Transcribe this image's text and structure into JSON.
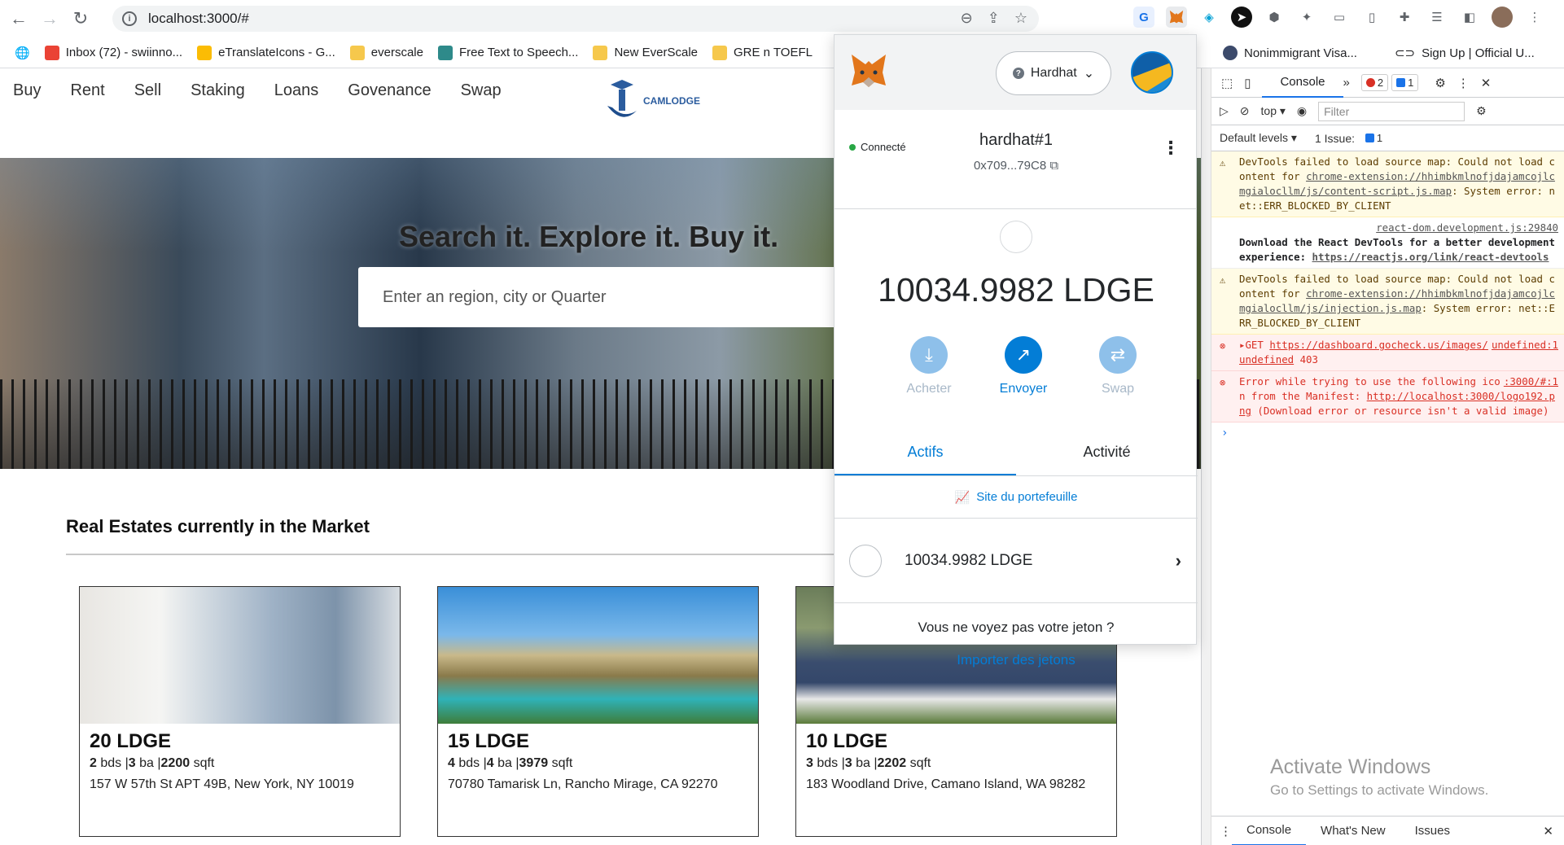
{
  "browser": {
    "url": "localhost:3000/#",
    "bookmarks": [
      {
        "label": "Inbox (72) - swiinno...",
        "color": "#ea4335"
      },
      {
        "label": "eTranslateIcons - G...",
        "color": "#fbbc04"
      },
      {
        "label": "everscale",
        "color": "#f6c84c"
      },
      {
        "label": "Free Text to Speech...",
        "color": "#2e8a8a"
      },
      {
        "label": "New EverScale",
        "color": "#f6c84c"
      },
      {
        "label": "GRE n TOEFL",
        "color": "#f6c84c"
      }
    ],
    "bookmarks_right": [
      "Nonimmigrant Visa...",
      "Sign Up | Official U..."
    ]
  },
  "site": {
    "nav": [
      "Buy",
      "Rent",
      "Sell",
      "Staking",
      "Loans",
      "Govenance",
      "Swap"
    ],
    "logo_text": "CAMLODGE",
    "hero_title": "Search it. Explore it. Buy it.",
    "search_placeholder": "Enter an region, city or Quarter",
    "section_title": "Real Estates currently in the Market",
    "listings": [
      {
        "price": "20 LDGE",
        "beds": "2",
        "baths": "3",
        "sqft": "2200",
        "address": "157 W 57th St APT 49B, New York, NY 10019",
        "image": "interior-living-room"
      },
      {
        "price": "15 LDGE",
        "beds": "4",
        "baths": "4",
        "sqft": "3979",
        "address": "70780 Tamarisk Ln, Rancho Mirage, CA 92270",
        "image": "pool-house"
      },
      {
        "price": "10 LDGE",
        "beds": "3",
        "baths": "3",
        "sqft": "2202",
        "address": "183 Woodland Drive, Camano Island, WA 98282",
        "image": "blue-house-forest"
      }
    ],
    "labels": {
      "beds": "bds",
      "baths": "ba",
      "sqft": "sqft",
      "sep": "|"
    }
  },
  "metamask": {
    "network": "Hardhat",
    "connected": "Connecté",
    "account_name": "hardhat#1",
    "address": "0x709...79C8",
    "balance": "10034.9982 LDGE",
    "actions": [
      "Acheter",
      "Envoyer",
      "Swap"
    ],
    "tabs": [
      "Actifs",
      "Activité"
    ],
    "portfolio_link": "Site du portefeuille",
    "asset_balance": "10034.9982 LDGE",
    "no_token_text": "Vous ne voyez pas votre jeton ?",
    "import_link": "Importer des jetons",
    "accent": "#037dd6"
  },
  "devtools": {
    "tabs": [
      "Console"
    ],
    "error_count": "2",
    "info_count": "1",
    "context": "top",
    "filter_placeholder": "Filter",
    "default_levels": "Default levels",
    "issues": "1 Issue:",
    "issue_count": "1",
    "messages": [
      {
        "level": "warn",
        "text": "DevTools failed to load source map: Could not load content for ",
        "link": "chrome-extension://hhimbkmlnofjdajamcojlcmgialocllm/js/content-script.js.map",
        "tail": ": System error: net::ERR_BLOCKED_BY_CLIENT"
      },
      {
        "level": "info",
        "source": "react-dom.development.js:29840",
        "text": "Download the React DevTools for a better development experience: ",
        "link": "https://reactjs.org/link/react-devtools",
        "tail": ""
      },
      {
        "level": "warn",
        "text": "DevTools failed to load source map: Could not load content for ",
        "link": "chrome-extension://hhimbkmlnofjdajamcojlcmgialocllm/js/injection.js.map",
        "tail": ": System error: net::ERR_BLOCKED_BY_CLIENT"
      },
      {
        "level": "err",
        "source": "undefined:1",
        "text": "▸GET ",
        "link": "https://dashboard.gocheck.us/images/undefined",
        "tail": " 403"
      },
      {
        "level": "err",
        "source": ":3000/#:1",
        "text": "Error while trying to use the following icon from the Manifest: ",
        "link": "http://localhost:3000/logo192.png",
        "tail": " (Download error or resource isn't a valid image)"
      }
    ],
    "drawer_tabs": [
      "Console",
      "What's New",
      "Issues"
    ]
  },
  "watermark": {
    "title": "Activate Windows",
    "subtitle": "Go to Settings to activate Windows."
  }
}
